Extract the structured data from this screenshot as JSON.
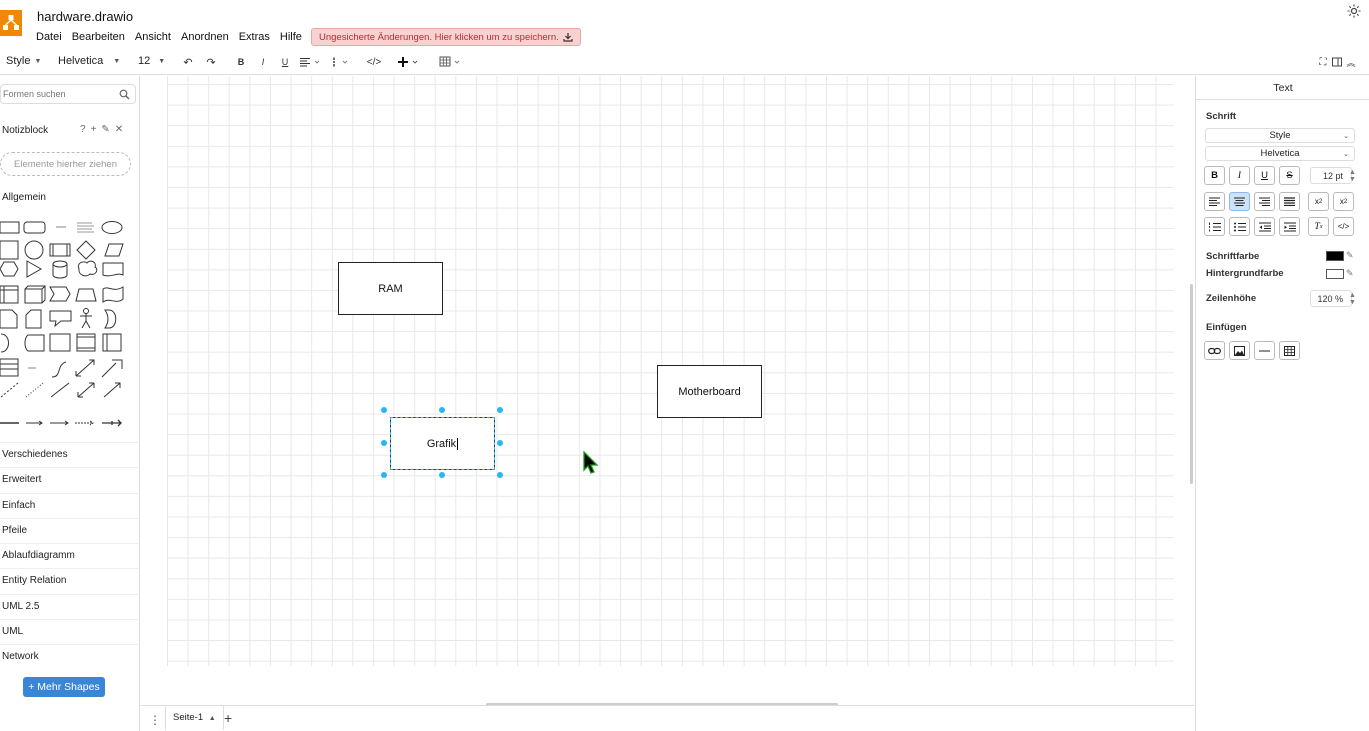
{
  "header": {
    "title": "hardware.drawio",
    "menu": [
      "Datei",
      "Bearbeiten",
      "Ansicht",
      "Anordnen",
      "Extras",
      "Hilfe"
    ],
    "unsaved_notice": "Ungesicherte Änderungen. Hier klicken um zu speichern."
  },
  "toolbar": {
    "style_label": "Style",
    "font_label": "Helvetica",
    "size_label": "12",
    "bold": "B",
    "italic": "I",
    "underline": "U"
  },
  "left": {
    "search_placeholder": "Formen suchen",
    "notizblock_title": "Notizblock",
    "dropzone_text": "Elemente hierher ziehen",
    "general_title": "Allgemein",
    "categories": [
      "Verschiedenes",
      "Erweitert",
      "Einfach",
      "Pfeile",
      "Ablaufdiagramm",
      "Entity Relation",
      "UML 2.5",
      "UML",
      "Network"
    ],
    "more_shapes": "+ Mehr Shapes"
  },
  "canvas": {
    "ram": "RAM",
    "motherboard": "Motherboard",
    "grafik": "Grafik"
  },
  "pages": {
    "current": "Seite-1"
  },
  "right": {
    "title": "Text",
    "schrift": "Schrift",
    "style_select": "Style",
    "font_select": "Helvetica",
    "font_size": "12 pt",
    "schriftfarbe": "Schriftfarbe",
    "hintergrundfarbe": "Hintergrundfarbe",
    "zeilenhoehe": "Zeilenhöhe",
    "line_height": "120 %",
    "einfuegen": "Einfügen"
  },
  "colors": {
    "accent": "#29b6f2",
    "logo": "#f08705",
    "button": "#3a86d6",
    "unsaved_bg": "#f9d1d1"
  }
}
